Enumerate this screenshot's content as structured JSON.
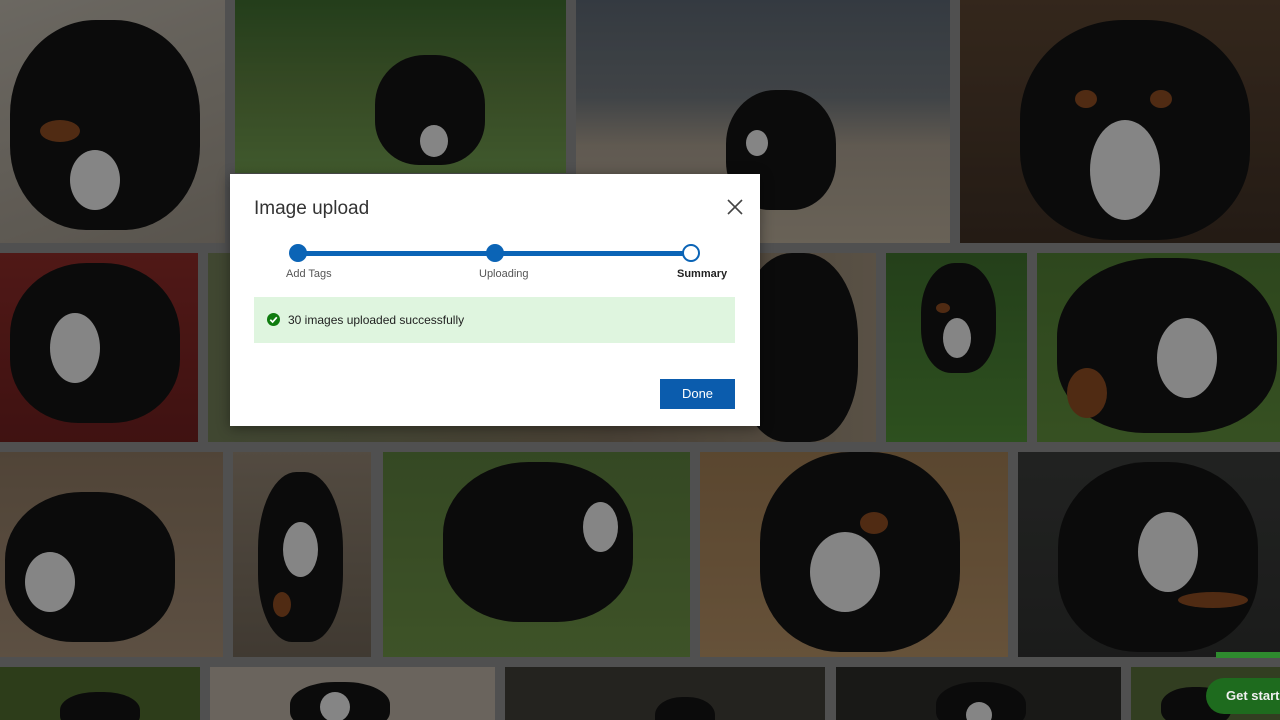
{
  "gallery": {
    "photo_count_visible": 18,
    "get_started_label": "Get starte"
  },
  "dialog": {
    "title": "Image upload",
    "close_icon": "close-icon",
    "steps": [
      {
        "label": "Add Tags",
        "state": "complete"
      },
      {
        "label": "Uploading",
        "state": "complete"
      },
      {
        "label": "Summary",
        "state": "current"
      }
    ],
    "success_icon": "check-circle-icon",
    "success_message": "30 images uploaded successfully",
    "done_label": "Done"
  },
  "colors": {
    "accent": "#0b64b6",
    "success_bg": "#dff5df",
    "success_icon": "#107c10"
  }
}
